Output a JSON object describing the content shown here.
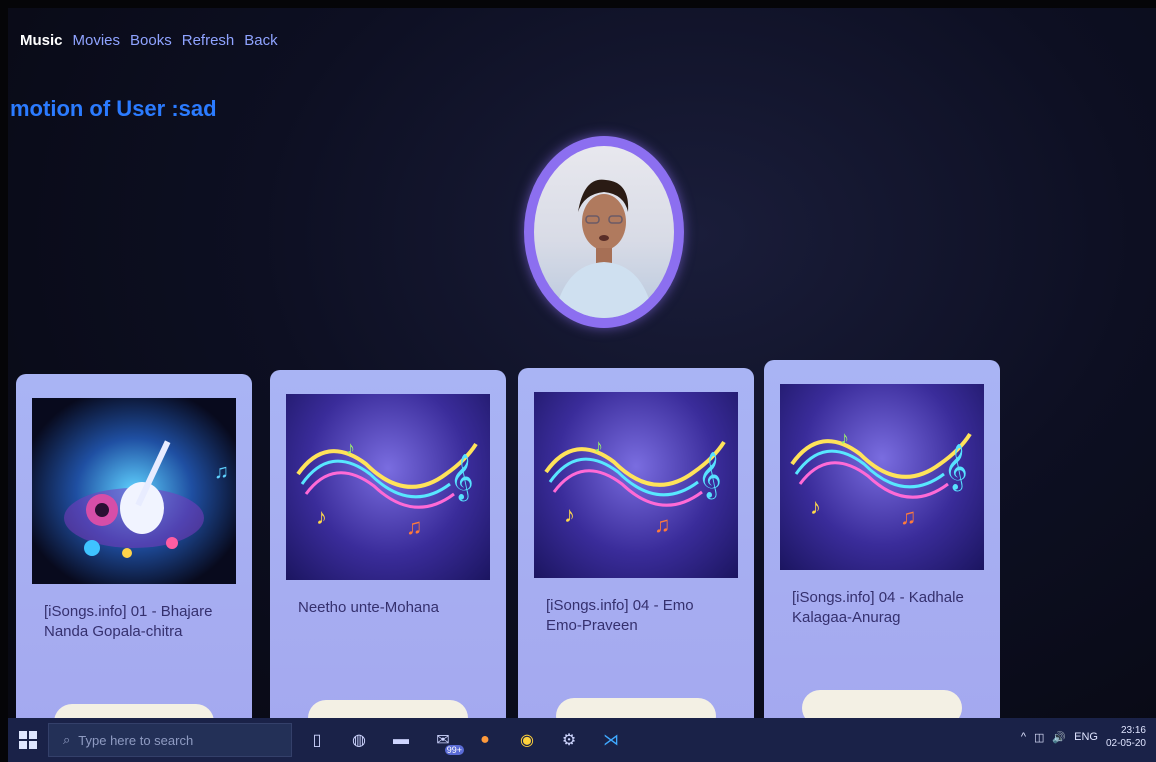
{
  "nav": {
    "items": [
      {
        "label": "Music",
        "active": true
      },
      {
        "label": "Movies",
        "active": false
      },
      {
        "label": "Books",
        "active": false
      },
      {
        "label": "Refresh",
        "active": false
      },
      {
        "label": "Back",
        "active": false
      }
    ]
  },
  "emotion_text": "motion of User :sad",
  "cards": [
    {
      "title": "[iSongs.info] 01 - Bhajare Nanda Gopala-chitra",
      "art": "guitar-art"
    },
    {
      "title": "Neetho unte-Mohana",
      "art": "music-notes-art"
    },
    {
      "title": "[iSongs.info] 04 - Emo Emo-Praveen",
      "art": "music-notes-art"
    },
    {
      "title": "[iSongs.info] 04 - Kadhale Kalagaa-Anurag",
      "art": "music-notes-art"
    }
  ],
  "taskbar": {
    "search_placeholder": "Type here to search",
    "mail_badge": "99+",
    "tray_lang": "ENG",
    "time": "23:16",
    "date": "02-05-20"
  },
  "colors": {
    "accent": "#8c6ff0",
    "card_bg": "#a9b4f4",
    "emotion": "#2b7bff"
  }
}
